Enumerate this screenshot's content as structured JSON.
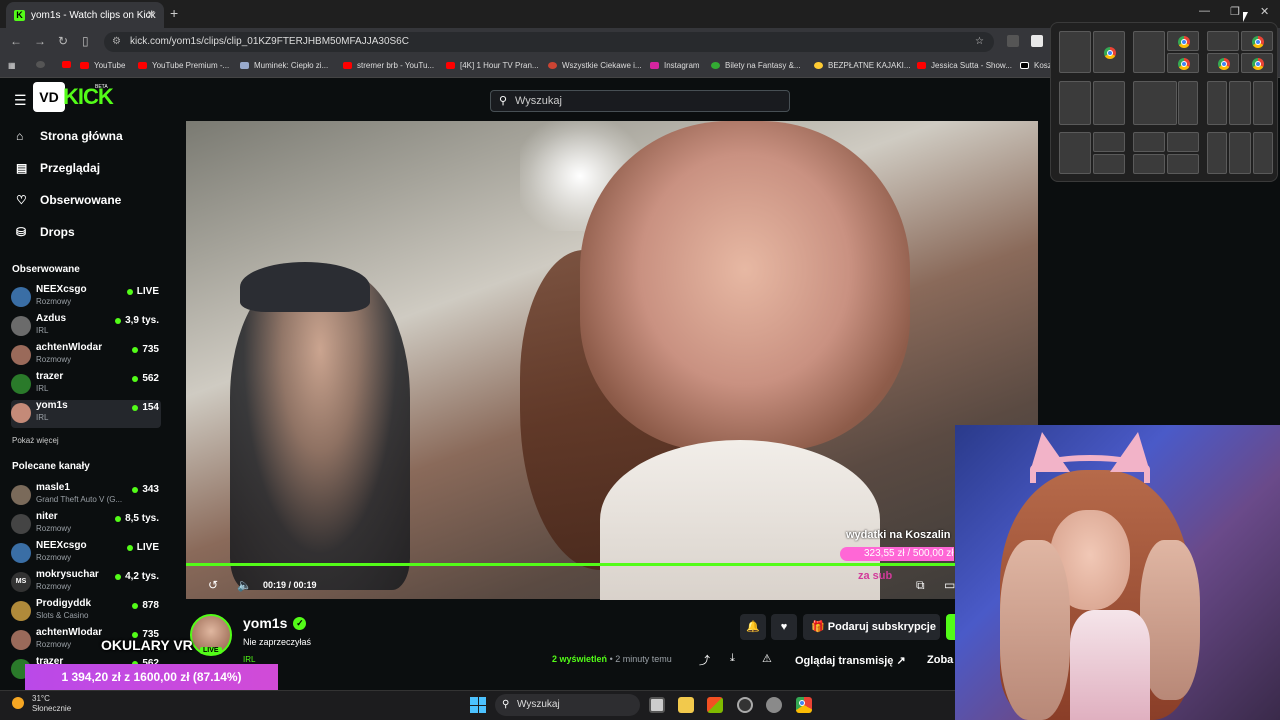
{
  "browser": {
    "tab_title": "yom1s - Watch clips on Kick",
    "favicon": "K",
    "url": "kick.com/yom1s/clips/clip_01KZ9FTERJHBM50MFAJJA30S6C",
    "bookmarks": [
      "YouTube",
      "YouTube Premium -...",
      "Muminek: Ciepło zi...",
      "stremer brb - YouTu...",
      "[4K] 1 Hour TV Pran...",
      "Wszystkie Ciekawe i...",
      "Instagram",
      "Bilety na Fantasy &...",
      "BEZPŁATNE KAJAKI...",
      "Jessica Sutta - Show...",
      "Kosz"
    ]
  },
  "header": {
    "logo_box": "VD",
    "logo_text": "KICK",
    "beta": "BETA",
    "search_placeholder": "Wyszukaj"
  },
  "nav": [
    {
      "label": "Strona główna",
      "icon": "home-icon"
    },
    {
      "label": "Przeglądaj",
      "icon": "browse-icon"
    },
    {
      "label": "Obserwowane",
      "icon": "heart-icon"
    },
    {
      "label": "Drops",
      "icon": "drops-icon"
    }
  ],
  "followed": {
    "heading": "Obserwowane",
    "show_more": "Pokaż więcej",
    "items": [
      {
        "name": "NEEXcsgo",
        "category": "Rozmowy",
        "viewers": "LIVE",
        "color": "#3a6ea5"
      },
      {
        "name": "Azdus",
        "category": "IRL",
        "viewers": "3,9 tys.",
        "color": "#6b6b6b"
      },
      {
        "name": "achtenWlodar",
        "category": "Rozmowy",
        "viewers": "735",
        "color": "#9a6a5a"
      },
      {
        "name": "trazer",
        "category": "IRL",
        "viewers": "562",
        "color": "#2a7a2a"
      },
      {
        "name": "yom1s",
        "category": "IRL",
        "viewers": "154",
        "color": "#c48a78"
      }
    ]
  },
  "recommended": {
    "heading": "Polecane kanały",
    "items": [
      {
        "name": "masle1",
        "category": "Grand Theft Auto V (G...",
        "viewers": "343",
        "color": "#7a6a5a"
      },
      {
        "name": "niter",
        "category": "Rozmowy",
        "viewers": "8,5 tys.",
        "color": "#444"
      },
      {
        "name": "NEEXcsgo",
        "category": "Rozmowy",
        "viewers": "LIVE",
        "color": "#3a6ea5"
      },
      {
        "name": "mokrysuchar",
        "category": "Rozmowy",
        "viewers": "4,2 tys.",
        "color": "#333",
        "initials": "MS"
      },
      {
        "name": "Prodigyddk",
        "category": "Slots & Casino",
        "viewers": "878",
        "color": "#b08a3a"
      },
      {
        "name": "achtenWlodar",
        "category": "Rozmowy",
        "viewers": "735",
        "color": "#9a6a5a"
      },
      {
        "name": "trazer",
        "category": "",
        "viewers": "562",
        "color": "#2a7a2a"
      }
    ]
  },
  "video": {
    "time": "00:19 / 00:19",
    "donation_title": "wydatki na Koszalin",
    "donation_amount": "323,55 zł / 500,00 zł",
    "donation_footer": "za sub"
  },
  "channel": {
    "name": "yom1s",
    "title": "Nie zaprzeczyłaś",
    "category": "IRL",
    "live": "LIVE",
    "views_count": "2",
    "views_label": "wyświetleń",
    "age": "• 2 minuty temu",
    "sub_button": "Podaruj subskrypcje",
    "watch_button": "Oglądaj transmisję",
    "see_button": "Zoba"
  },
  "overlay": {
    "okulary": "OKULARY VR",
    "goal": "1 394,20 zł z 1600,00 zł (87.14%)",
    "goal_fraction": 0.8714
  },
  "taskbar": {
    "temp": "31°C",
    "weather": "Słonecznie",
    "search": "Wyszukaj"
  }
}
